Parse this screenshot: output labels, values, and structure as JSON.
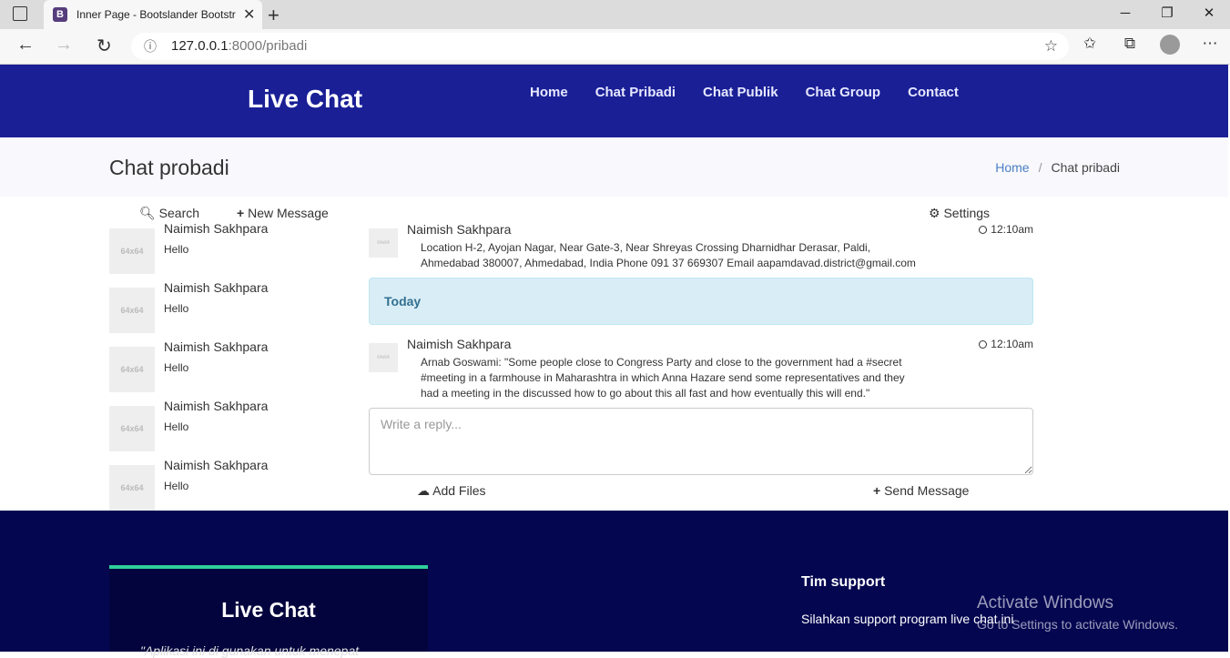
{
  "browser": {
    "tab_title": "Inner Page - Bootslander Bootstrap Template",
    "tab_favicon": "B",
    "url_host": "127.0.0.1",
    "url_rest": ":8000/pribadi"
  },
  "header": {
    "logo": "Live Chat",
    "menu": [
      "Home",
      "Chat Pribadi",
      "Chat Publik",
      "Chat Group",
      "Contact"
    ]
  },
  "breadcrumb": {
    "title": "Chat probadi",
    "home": "Home",
    "separator": "/",
    "current": "Chat pribadi"
  },
  "toolbar": {
    "search": "Search",
    "new_message": "New Message",
    "settings": "Settings"
  },
  "contacts": [
    {
      "thumb": "64x64",
      "name": "Naimish Sakhpara",
      "message": "Hello"
    },
    {
      "thumb": "64x64",
      "name": "Naimish Sakhpara",
      "message": "Hello"
    },
    {
      "thumb": "64x64",
      "name": "Naimish Sakhpara",
      "message": "Hello"
    },
    {
      "thumb": "64x64",
      "name": "Naimish Sakhpara",
      "message": "Hello"
    },
    {
      "thumb": "64x64",
      "name": "Naimish Sakhpara",
      "message": "Hello"
    }
  ],
  "messages": [
    {
      "thumb": "64x64",
      "name": "Naimish Sakhpara",
      "time": "12:10am",
      "text": "Location H-2, Ayojan Nagar, Near Gate-3, Near Shreyas Crossing Dharnidhar Derasar, Paldi, Ahmedabad 380007, Ahmedabad, India Phone 091 37 669307 Email aapamdavad.district@gmail.com"
    },
    {
      "thumb": "64x64",
      "name": "Naimish Sakhpara",
      "time": "12:10am",
      "text": "Arnab Goswami: \"Some people close to Congress Party and close to the government had a #secret #meeting in a farmhouse in Maharashtra in which Anna Hazare send some representatives and they had a meeting in the discussed how to go about this all fast and how eventually this will end.\""
    }
  ],
  "divider": "Today",
  "reply": {
    "placeholder": "Write a reply...",
    "add_files": "Add Files",
    "send": "Send Message"
  },
  "footer": {
    "card_title": "Live Chat",
    "card_quote": "\"Aplikasi ini di gunakan untuk menepat",
    "support_title": "Tim support",
    "support_text": "Silahkan support program live chat ini"
  },
  "watermark": {
    "line1": "Activate Windows",
    "line2": "Go to Settings to activate Windows."
  },
  "colors": {
    "header_bg": "#1a1f96",
    "footer_bg": "#040650",
    "accent": "#2fcf9b",
    "today_bg": "#d9edf7"
  }
}
